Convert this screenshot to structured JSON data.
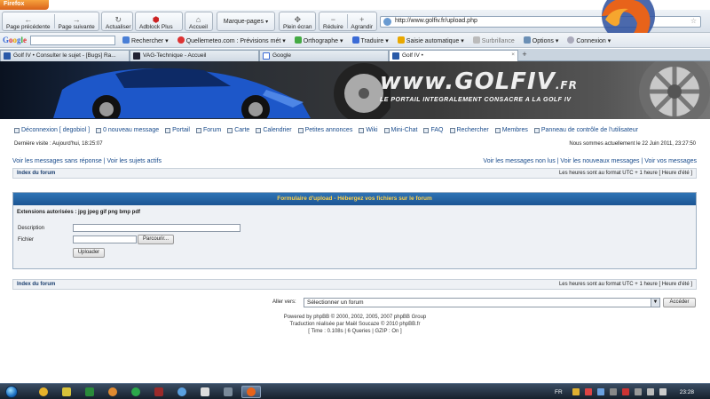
{
  "browser": {
    "app_button": "Firefox",
    "toolbar": {
      "back": "Page précédente",
      "forward": "Page suivante",
      "reload": "Actualiser",
      "adblock": "Adblock Plus",
      "home": "Accueil",
      "bookmarks": "Marque-pages",
      "fullscreen": "Plein écran",
      "zoom_out": "Réduire",
      "zoom_in": "Agrandir"
    },
    "url": "http://www.golfiv.fr/upload.php",
    "google_bar": {
      "logo": [
        "G",
        "o",
        "o",
        "g",
        "l",
        "e"
      ],
      "items": [
        "Rechercher ▾",
        "Quellemeteo.com : Prévisions mét ▾",
        "Orthographe ▾",
        "Traduire ▾",
        "Saisie automatique ▾",
        "Surbrillance",
        "Options ▾",
        "Connexion ▾"
      ]
    },
    "tabs": [
      {
        "label": "Golf IV • Consulter le sujet - [Bugs] Ra...",
        "active": false
      },
      {
        "label": "VAG-Technique - Accueil",
        "active": false
      },
      {
        "label": "Google",
        "active": false
      },
      {
        "label": "Golf IV •",
        "active": true
      }
    ]
  },
  "banner": {
    "site": "www.GOLFIV",
    "site_ext": ".FR",
    "tagline": "LE PORTAIL INTEGRALEMENT CONSACRE A LA GOLF IV"
  },
  "forum": {
    "nav": [
      {
        "label": "Déconnexion [ degobiol ]",
        "icon": "door-icon"
      },
      {
        "label": "0 nouveau message",
        "icon": "mail-icon"
      },
      {
        "label": "Portail",
        "icon": "portal-icon"
      },
      {
        "label": "Forum",
        "icon": "forum-icon"
      },
      {
        "label": "Carte",
        "icon": "map-icon"
      },
      {
        "label": "Calendrier",
        "icon": "calendar-icon"
      },
      {
        "label": "Petites annonces",
        "icon": "ads-icon"
      },
      {
        "label": "Wiki",
        "icon": "wiki-icon"
      },
      {
        "label": "Mini-Chat",
        "icon": "chat-icon"
      },
      {
        "label": "FAQ",
        "icon": "faq-icon"
      },
      {
        "label": "Rechercher",
        "icon": "search-icon"
      },
      {
        "label": "Membres",
        "icon": "members-icon"
      },
      {
        "label": "Panneau de contrôle de l'utilisateur",
        "icon": "control-panel-icon"
      }
    ],
    "last_visit": "Dernière visite : Aujourd'hui, 18:25:07",
    "current_time": "Nous sommes actuellement le 22 Juin 2011, 23:27:50",
    "links_left": "Voir les messages sans réponse | Voir les sujets actifs",
    "links_right": "Voir les messages non lus | Voir les nouveaux messages | Voir vos messages",
    "index_label": "Index du forum",
    "timezone": "Les heures sont au format UTC + 1 heure [ Heure d'été ]",
    "upload": {
      "title": "Formulaire d'upload - Hébergez vos fichiers sur le forum",
      "extensions": "Extensions autorisées : jpg jpeg gif png bmp pdf",
      "description_label": "Description",
      "description_value": "",
      "file_label": "Fichier",
      "file_value": "",
      "browse_button": "Parcourir...",
      "submit_button": "Uploader"
    },
    "goto_label": "Aller vers:",
    "goto_selected": "Sélectionner un forum",
    "goto_button": "Accéder",
    "footer": [
      "Powered by phpBB © 2000, 2002, 2005, 2007 phpBB Group",
      "Traduction réalisée par Maël Soucaze © 2010 phpBB.fr",
      "[ Time : 0.108s | 6 Queries | GZIP : On ]"
    ]
  },
  "taskbar": {
    "language": "FR",
    "clock": "23:28"
  },
  "colors": {
    "link": "#1a4c8c",
    "upload_header": "#1c5593",
    "upload_title": "#ffd24a",
    "taskbar": "#16202c"
  }
}
